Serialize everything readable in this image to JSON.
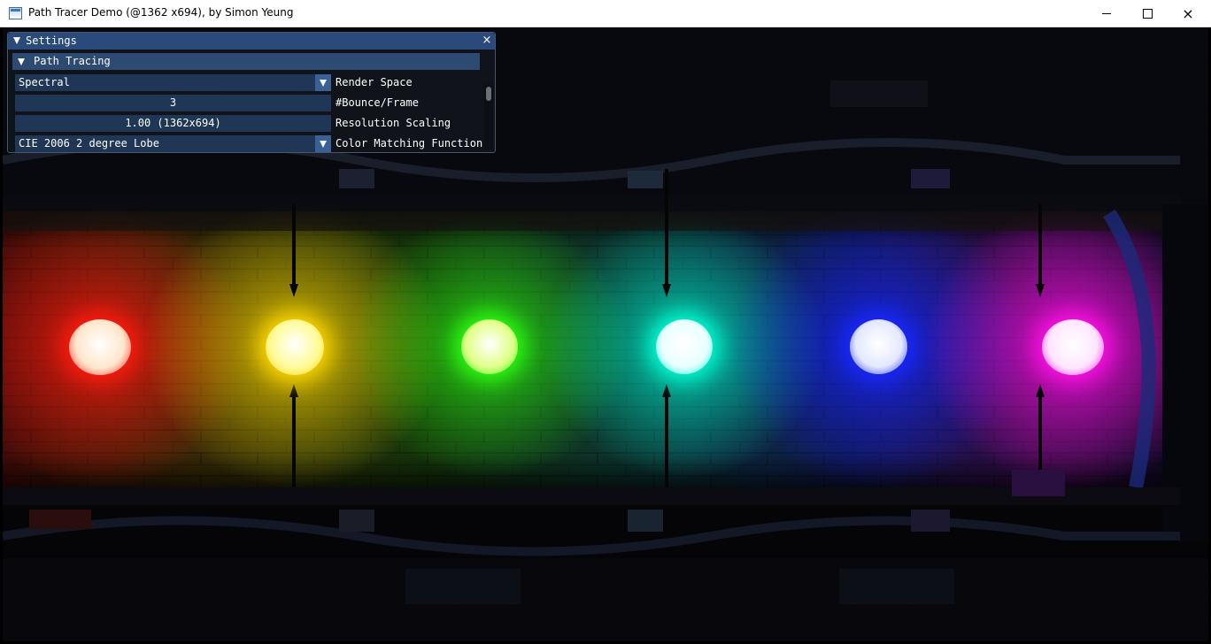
{
  "window": {
    "title": "Path Tracer Demo (@1362 x694), by Simon Yeung",
    "icon": "app-window-icon",
    "controls": {
      "minimize": "minimize-icon",
      "maximize": "maximize-icon",
      "close": "×"
    }
  },
  "settings": {
    "title": "Settings",
    "close_glyph": "×",
    "section": "Path Tracing",
    "rows": [
      {
        "value": "Spectral",
        "label": "Render Space",
        "kind": "combo"
      },
      {
        "value": "3",
        "label": "#Bounce/Frame",
        "kind": "slider"
      },
      {
        "value": "1.00 (1362x694)",
        "label": "Resolution Scaling",
        "kind": "slider"
      },
      {
        "value": "CIE 2006 2 degree Lobe",
        "label": "Color Matching Function",
        "kind": "combo"
      }
    ]
  },
  "scene": {
    "lights": [
      {
        "name": "red",
        "glow": "#ff1a10",
        "core": "#ffe6cc"
      },
      {
        "name": "yellow",
        "glow": "#ffd800",
        "core": "#fffb9a"
      },
      {
        "name": "green",
        "glow": "#2cff10",
        "core": "#e2ff8a"
      },
      {
        "name": "cyan",
        "glow": "#00ffd4",
        "core": "#eaffff"
      },
      {
        "name": "blue",
        "glow": "#1828ff",
        "core": "#e4e8ff"
      },
      {
        "name": "magenta",
        "glow": "#ff10e6",
        "core": "#ffe6ff"
      }
    ]
  }
}
